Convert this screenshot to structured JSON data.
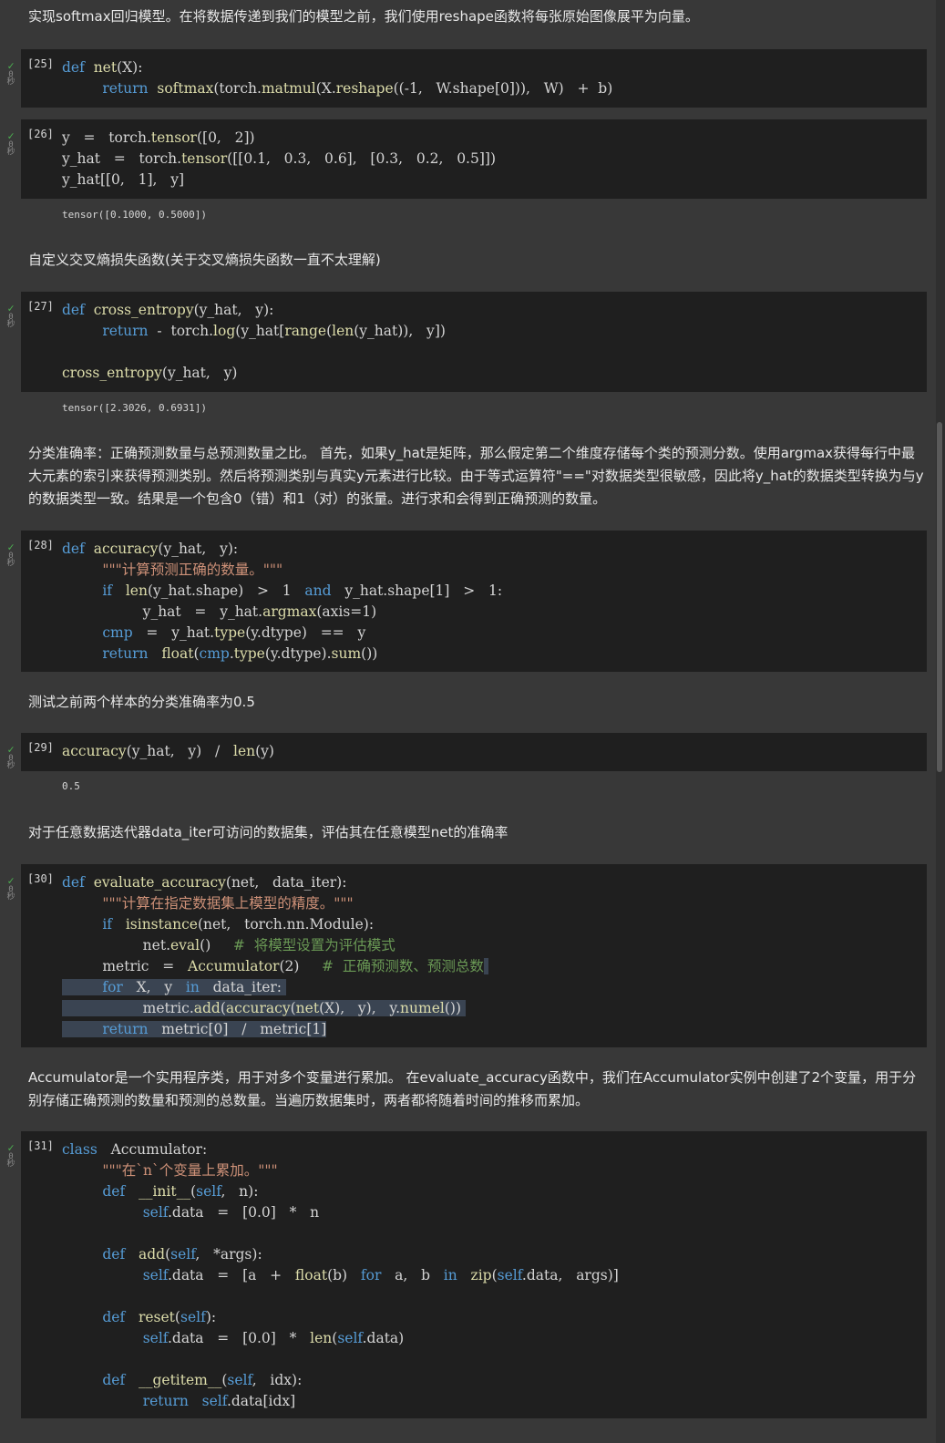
{
  "md": {
    "intro": "实现softmax回归模型。在将数据传递到我们的模型之前，我们使用reshape函数将每张原始图像展平为向量。",
    "ce_title": "自定义交叉熵损失函数(关于交叉熵损失函数一直不太理解)",
    "acc_desc": "分类准确率：正确预测数量与总预测数量之比。 首先，如果y_hat是矩阵，那么假定第二个维度存储每个类的预测分数。使用argmax获得每行中最大元素的索引来获得预测类别。然后将预测类别与真实y元素进行比较。由于等式运算符\"==\"对数据类型很敏感，因此将y_hat的数据类型转换为与y的数据类型一致。结果是一个包含0（错）和1（对）的张量。进行求和会得到正确预测的数量。",
    "test_acc": "测试之前两个样本的分类准确率为0.5",
    "eval_desc": "对于任意数据迭代器data_iter可访问的数据集，评估其在任意模型net的准确率",
    "accum_desc": "Accumulator是一个实用程序类，用于对多个变量进行累加。 在evaluate_accuracy函数中，我们在Accumulator实例中创建了2个变量，用于分别存储正确预测的数量和预测的总数量。当遍历数据集时，两者都将随着时间的推移而累加。"
  },
  "cells": {
    "c25": {
      "prompt": "[25]"
    },
    "c26": {
      "prompt": "[26]",
      "output": "tensor([0.1000, 0.5000])"
    },
    "c27": {
      "prompt": "[27]",
      "output": "tensor([2.3026, 0.6931])"
    },
    "c28": {
      "prompt": "[28]"
    },
    "c29": {
      "prompt": "[29]",
      "output": "0.5"
    },
    "c30": {
      "prompt": "[30]"
    },
    "c31": {
      "prompt": "[31]"
    }
  },
  "gutter": {
    "check": "✓",
    "count": "0",
    "unit": "秒"
  },
  "colors": {
    "keyword": "#569cd6",
    "string": "#ce9178",
    "comment": "#6a9955",
    "cell_bg": "#1f1f1f",
    "page_bg": "#383838"
  }
}
